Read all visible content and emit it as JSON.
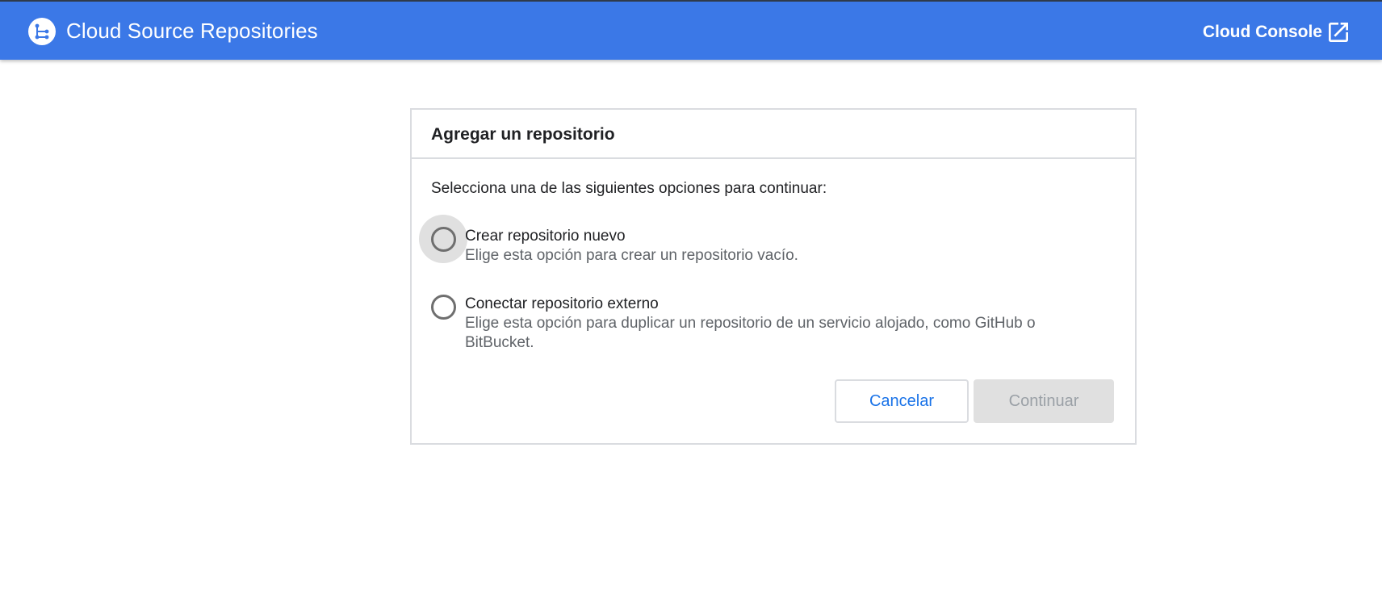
{
  "header": {
    "app_title": "Cloud Source Repositories",
    "console_link": "Cloud Console",
    "logo_icon": "source-repositories-icon",
    "external_icon": "open-in-new-icon",
    "bar_color": "#3b78e7"
  },
  "dialog": {
    "title": "Agregar un repositorio",
    "instruction": "Selecciona una de las siguientes opciones para continuar:",
    "options": [
      {
        "label": "Crear repositorio nuevo",
        "description": "Elige esta opción para crear un repositorio vacío.",
        "selected": false
      },
      {
        "label": "Conectar repositorio externo",
        "description": "Elige esta opción para duplicar un repositorio de un servicio alojado, como GitHub o BitBucket.",
        "selected": false
      }
    ],
    "cancel_label": "Cancelar",
    "continue_label": "Continuar",
    "continue_enabled": false,
    "accent_color": "#1a73e8"
  }
}
